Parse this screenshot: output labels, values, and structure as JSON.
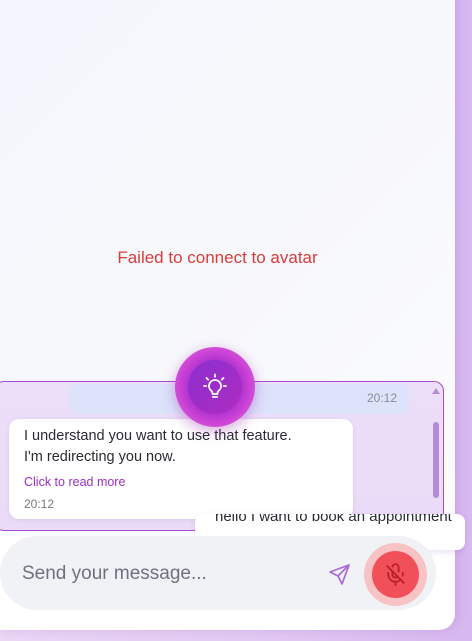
{
  "avatar": {
    "error_text": "Failed to connect to avatar"
  },
  "chat": {
    "previous_message_time": "20:12",
    "bot_message": {
      "text_line1": "I understand you want to use that feature.",
      "text_line2": "I'm redirecting you now.",
      "read_more_label": "Click to read more",
      "time": "20:12"
    },
    "user_message": {
      "text": "hello I want to book an appointment"
    }
  },
  "composer": {
    "placeholder": "Send your message...",
    "value": ""
  },
  "icons": {
    "hint": "lightbulb-icon",
    "send": "send-icon",
    "mic": "mic-off-icon"
  },
  "colors": {
    "accent": "#a12fc9",
    "error": "#dc3b3b",
    "mic_active": "#f25058"
  }
}
